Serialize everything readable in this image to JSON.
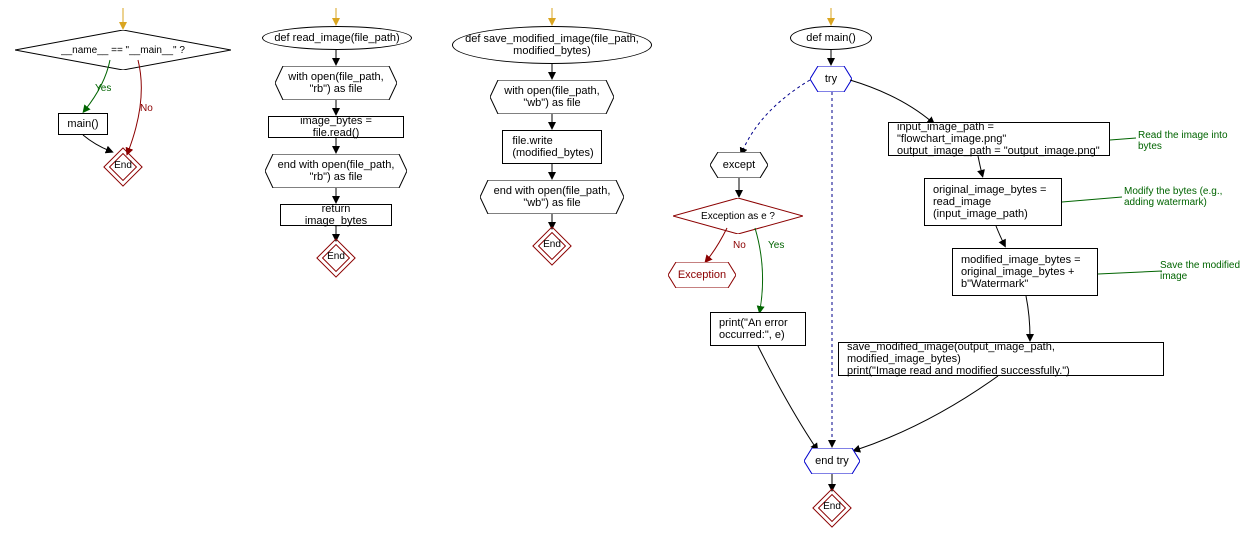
{
  "flowchart1": {
    "condition": "__name__ == \"__main__\" ?",
    "yes": "Yes",
    "no": "No",
    "call": "main()",
    "end": "End"
  },
  "flowchart2": {
    "def": "def read_image(file_path)",
    "with_open": "with open(file_path, \"rb\") as file",
    "read": "image_bytes = file.read()",
    "end_with": "end with open(file_path, \"rb\") as file",
    "return": "return image_bytes",
    "end": "End"
  },
  "flowchart3": {
    "def": "def save_modified_image(file_path, modified_bytes)",
    "with_open": "with open(file_path, \"wb\") as file",
    "write": "file.write (modified_bytes)",
    "end_with": "end with open(file_path, \"wb\") as file",
    "end": "End"
  },
  "flowchart4": {
    "def": "def main()",
    "try": "try",
    "except": "except",
    "exception_cond": "Exception as e ?",
    "no": "No",
    "yes": "Yes",
    "exception_raise": "Exception",
    "print_error": "print(\"An error occurred:\", e)",
    "paths": "input_image_path = \"flowchart_image.png\"\noutput_image_path = \"output_image.png\"",
    "read_call": "original_image_bytes = read_image (input_image_path)",
    "modify": "modified_image_bytes = original_image_bytes + b\"Watermark\"",
    "save_print": "save_modified_image(output_image_path, modified_image_bytes)\nprint(\"Image read and modified successfully.\")",
    "end_try": "end try",
    "end": "End",
    "comment1": "Read the image into bytes",
    "comment2": "Modify the bytes (e.g., adding watermark)",
    "comment3": "Save the modified image"
  }
}
